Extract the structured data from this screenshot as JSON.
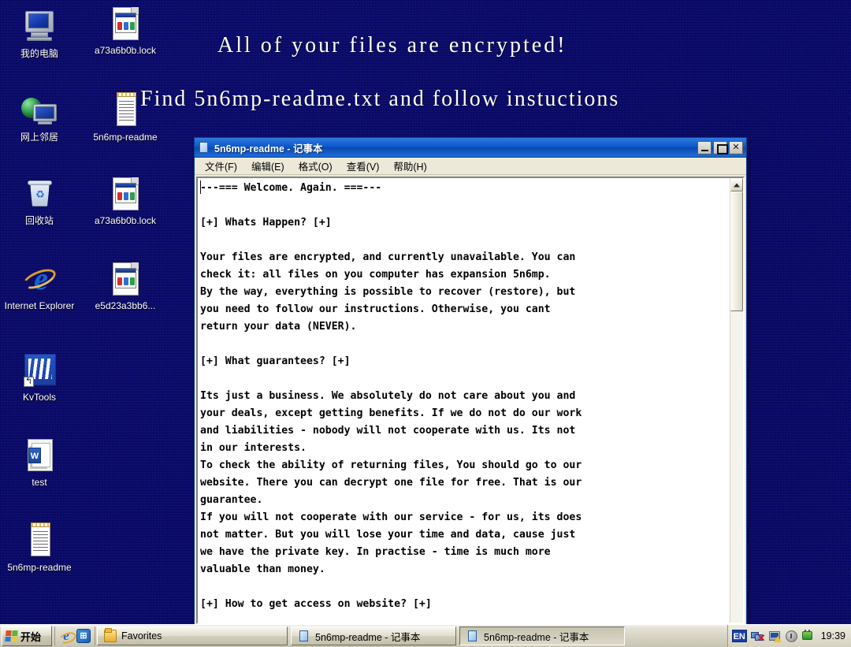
{
  "desktop": {
    "wallpaper_color": "#13138a",
    "banner": {
      "line1": "All of your files are encrypted!",
      "line2": "Find 5n6mp-readme.txt and follow instuctions"
    },
    "icons": [
      {
        "label": "我的电脑",
        "icon": "my-computer-icon"
      },
      {
        "label": "a73a6b0b.lock",
        "icon": "locked-file-icon"
      },
      {
        "label": "网上邻居",
        "icon": "network-neighborhood-icon"
      },
      {
        "label": "5n6mp-readme",
        "icon": "text-file-icon"
      },
      {
        "label": "回收站",
        "icon": "recycle-bin-icon"
      },
      {
        "label": "a73a6b0b.lock",
        "icon": "locked-file-icon"
      },
      {
        "label": "Internet Explorer",
        "icon": "internet-explorer-icon"
      },
      {
        "label": "e5d23a3bb6...",
        "icon": "locked-file-icon"
      },
      {
        "label": "KvTools",
        "icon": "kvtools-icon"
      },
      {
        "label": "test",
        "icon": "word-document-icon"
      },
      {
        "label": "5n6mp-readme",
        "icon": "text-file-icon"
      }
    ]
  },
  "notepad": {
    "title": "5n6mp-readme - 记事本",
    "menu": [
      {
        "label": "文件(F)",
        "key": "F"
      },
      {
        "label": "编辑(E)",
        "key": "E"
      },
      {
        "label": "格式(O)",
        "key": "O"
      },
      {
        "label": "查看(V)",
        "key": "V"
      },
      {
        "label": "帮助(H)",
        "key": "H"
      }
    ],
    "window_buttons": {
      "minimize": "minimize",
      "maximize": "maximize",
      "close": "✕"
    },
    "content": "---=== Welcome. Again. ===---\n\n[+] Whats Happen? [+]\n\nYour files are encrypted, and currently unavailable. You can\ncheck it: all files on you computer has expansion 5n6mp.\nBy the way, everything is possible to recover (restore), but\nyou need to follow our instructions. Otherwise, you cant\nreturn your data (NEVER).\n\n[+] What guarantees? [+]\n\nIts just a business. We absolutely do not care about you and\nyour deals, except getting benefits. If we do not do our work\nand liabilities - nobody will not cooperate with us. Its not\nin our interests.\nTo check the ability of returning files, You should go to our\nwebsite. There you can decrypt one file for free. That is our\nguarantee.\nIf you will not cooperate with our service - for us, its does\nnot matter. But you will lose your time and data, cause just\nwe have the private key. In practise - time is much more\nvaluable than money.\n\n[+] How to get access on website? [+]\n"
  },
  "taskbar": {
    "start_label": "开始",
    "quicklaunch": [
      {
        "name": "internet-explorer-icon"
      },
      {
        "name": "program-icon"
      }
    ],
    "windows": [
      {
        "label": "Favorites",
        "icon": "folder-icon",
        "active": false
      },
      {
        "label": "5n6mp-readme - 记事本",
        "icon": "notepad-icon",
        "active": false
      },
      {
        "label": "5n6mp-readme - 记事本",
        "icon": "notepad-icon",
        "active": true
      }
    ],
    "tray": {
      "language": "EN",
      "icons": [
        "network-disconnected-icon",
        "antivirus-warning-icon",
        "clock-shield-icon",
        "plug-icon"
      ],
      "clock": "19:39"
    }
  }
}
